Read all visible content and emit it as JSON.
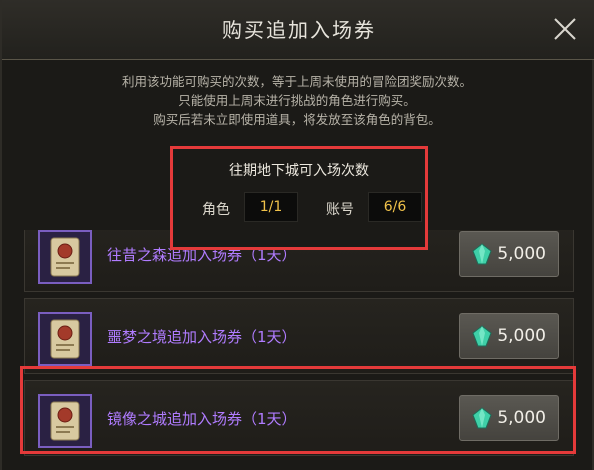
{
  "dialog": {
    "title": "购买追加入场券",
    "close_icon": "close-icon"
  },
  "info": {
    "line1": "利用该功能可购买的次数，等于上周未使用的冒险团奖励次数。",
    "line2": "只能使用上周末进行挑战的角色进行购买。",
    "line3": "购买后若未立即使用道具，将发放至该角色的背包。"
  },
  "entry_count": {
    "title": "往期地下城可入场次数",
    "character_label": "角色",
    "character_value": "1/1",
    "account_label": "账号",
    "account_value": "6/6"
  },
  "items": [
    {
      "name": "往昔之森追加入场券（1天）",
      "price": "5,000",
      "icon": "ticket-scroll-icon"
    },
    {
      "name": "噩梦之境追加入场券（1天）",
      "price": "5,000",
      "icon": "ticket-scroll-icon"
    },
    {
      "name": "镜像之城追加入场券（1天）",
      "price": "5,000",
      "icon": "ticket-scroll-icon"
    }
  ],
  "colors": {
    "highlight": "#e43a3a",
    "item_name": "#b07cff",
    "count_value": "#f0c24a",
    "gem": "#3fd0a8"
  }
}
